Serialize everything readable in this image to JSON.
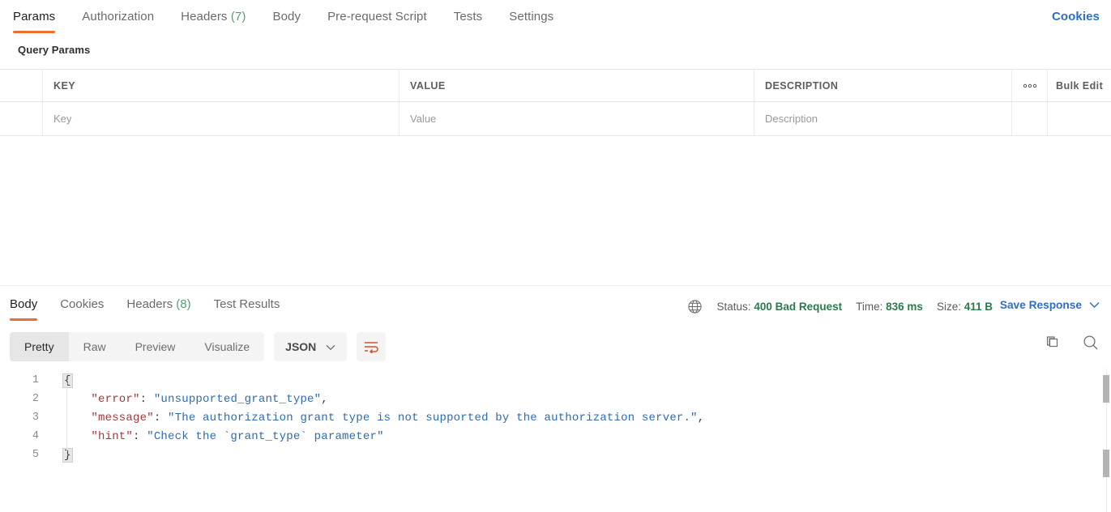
{
  "request_tabs": [
    {
      "label": "Params",
      "count": null,
      "active": true
    },
    {
      "label": "Authorization",
      "count": null,
      "active": false
    },
    {
      "label": "Headers",
      "count": "(7)",
      "active": false
    },
    {
      "label": "Body",
      "count": null,
      "active": false
    },
    {
      "label": "Pre-request Script",
      "count": null,
      "active": false
    },
    {
      "label": "Tests",
      "count": null,
      "active": false
    },
    {
      "label": "Settings",
      "count": null,
      "active": false
    }
  ],
  "cookies_link": "Cookies",
  "query_params": {
    "section_title": "Query Params",
    "columns": [
      "KEY",
      "VALUE",
      "DESCRIPTION"
    ],
    "more_options_icon": "ooo",
    "bulk_edit_label": "Bulk Edit",
    "rows": [
      {
        "key_placeholder": "Key",
        "value_placeholder": "Value",
        "description_placeholder": "Description"
      }
    ]
  },
  "response": {
    "tabs": [
      {
        "label": "Body",
        "count": null,
        "active": true
      },
      {
        "label": "Cookies",
        "count": null,
        "active": false
      },
      {
        "label": "Headers",
        "count": "(8)",
        "active": false
      },
      {
        "label": "Test Results",
        "count": null,
        "active": false
      }
    ],
    "globe_icon": "globe-icon",
    "meta": {
      "status_label": "Status:",
      "status_value": "400 Bad Request",
      "time_label": "Time:",
      "time_value": "836 ms",
      "size_label": "Size:",
      "size_value": "411 B"
    },
    "save_response_label": "Save Response",
    "view_modes": [
      {
        "label": "Pretty",
        "active": true
      },
      {
        "label": "Raw",
        "active": false
      },
      {
        "label": "Preview",
        "active": false
      },
      {
        "label": "Visualize",
        "active": false
      }
    ],
    "format_selected": "JSON",
    "wrap_icon": "word-wrap-icon",
    "copy_icon": "copy-icon",
    "search_icon": "search-icon",
    "body_lines": [
      {
        "n": "1",
        "segments": [
          {
            "t": "{",
            "c": "brace"
          }
        ]
      },
      {
        "n": "2",
        "segments": [
          {
            "t": "    ",
            "c": "plain"
          },
          {
            "t": "\"error\"",
            "c": "key"
          },
          {
            "t": ": ",
            "c": "punc"
          },
          {
            "t": "\"unsupported_grant_type\"",
            "c": "str"
          },
          {
            "t": ",",
            "c": "punc"
          }
        ]
      },
      {
        "n": "3",
        "segments": [
          {
            "t": "    ",
            "c": "plain"
          },
          {
            "t": "\"message\"",
            "c": "key"
          },
          {
            "t": ": ",
            "c": "punc"
          },
          {
            "t": "\"The authorization grant type is not supported by the authorization server.\"",
            "c": "str"
          },
          {
            "t": ",",
            "c": "punc"
          }
        ]
      },
      {
        "n": "4",
        "segments": [
          {
            "t": "    ",
            "c": "plain"
          },
          {
            "t": "\"hint\"",
            "c": "key"
          },
          {
            "t": ": ",
            "c": "punc"
          },
          {
            "t": "\"Check the `grant_type` parameter\"",
            "c": "str"
          }
        ]
      },
      {
        "n": "5",
        "segments": [
          {
            "t": "}",
            "c": "brace"
          }
        ]
      }
    ]
  },
  "colors": {
    "accent_orange": "#ef6c33",
    "link_blue": "#2e6ec7",
    "status_green": "#2c7a4b",
    "json_key": "#a4373a",
    "json_string": "#2f6bb0",
    "count_green": "#52a270"
  }
}
